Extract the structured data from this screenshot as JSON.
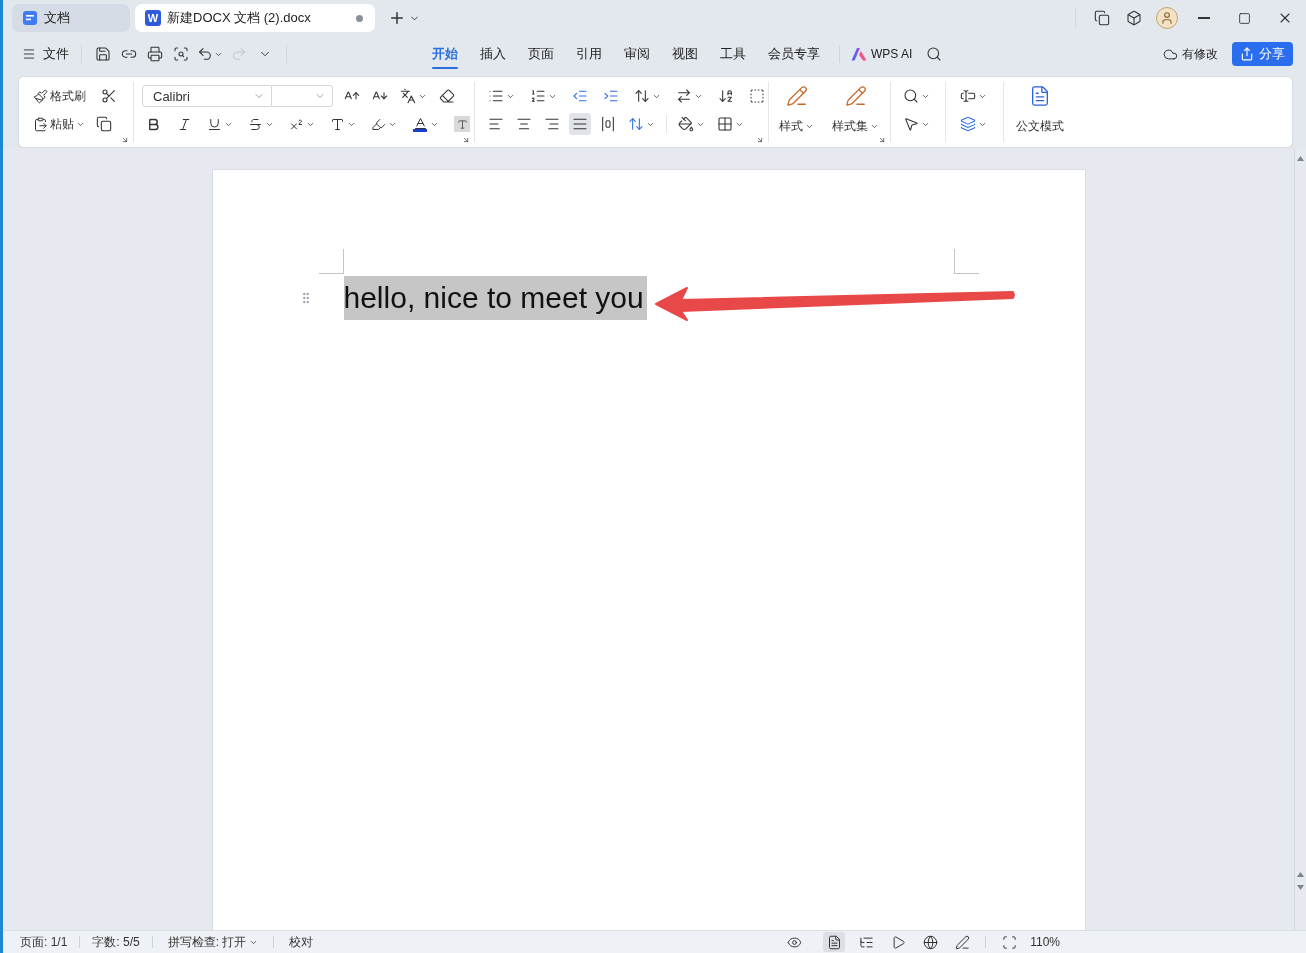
{
  "title_bar": {
    "tabs": [
      {
        "kind": "docs",
        "label": "文档",
        "selected": false
      },
      {
        "kind": "writer",
        "logo_letter": "W",
        "label": "新建DOCX 文档 (2).docx",
        "selected": true,
        "modified": true
      }
    ]
  },
  "menu_bar": {
    "file_label": "文件",
    "redo_disabled": true,
    "tabs": [
      {
        "label": "开始",
        "selected": true
      },
      {
        "label": "插入",
        "selected": false
      },
      {
        "label": "页面",
        "selected": false
      },
      {
        "label": "引用",
        "selected": false
      },
      {
        "label": "审阅",
        "selected": false
      },
      {
        "label": "视图",
        "selected": false
      },
      {
        "label": "工具",
        "selected": false
      },
      {
        "label": "会员专享",
        "selected": false
      }
    ],
    "ai_label": "WPS AI",
    "save_status": "有修改",
    "share_label": "分享"
  },
  "ribbon": {
    "format_painter_label": "格式刷",
    "paste_label": "粘贴",
    "font_family": "Calibri",
    "alignment": [
      {
        "kind": "left",
        "selected": false
      },
      {
        "kind": "center",
        "selected": false
      },
      {
        "kind": "right",
        "selected": false
      },
      {
        "kind": "justify",
        "selected": true
      },
      {
        "kind": "distributed",
        "selected": false
      }
    ],
    "style_label": "样式",
    "style_set_label": "样式集",
    "document_mode_label": "公文模式"
  },
  "document": {
    "paragraphs": [
      {
        "text": "hello, nice to meet you",
        "selected": true
      }
    ]
  },
  "status_bar": {
    "page": "页面: 1/1",
    "word_count": "字数: 5/5",
    "spell_check": "拼写检查: 打开",
    "proofread": "校对",
    "views": [
      {
        "kind": "read",
        "selected": false
      },
      {
        "kind": "page",
        "selected": true
      },
      {
        "kind": "outline",
        "selected": false
      },
      {
        "kind": "slideshow",
        "selected": false
      },
      {
        "kind": "web",
        "selected": false
      },
      {
        "kind": "pen",
        "selected": false
      }
    ],
    "zoom": "110%"
  }
}
